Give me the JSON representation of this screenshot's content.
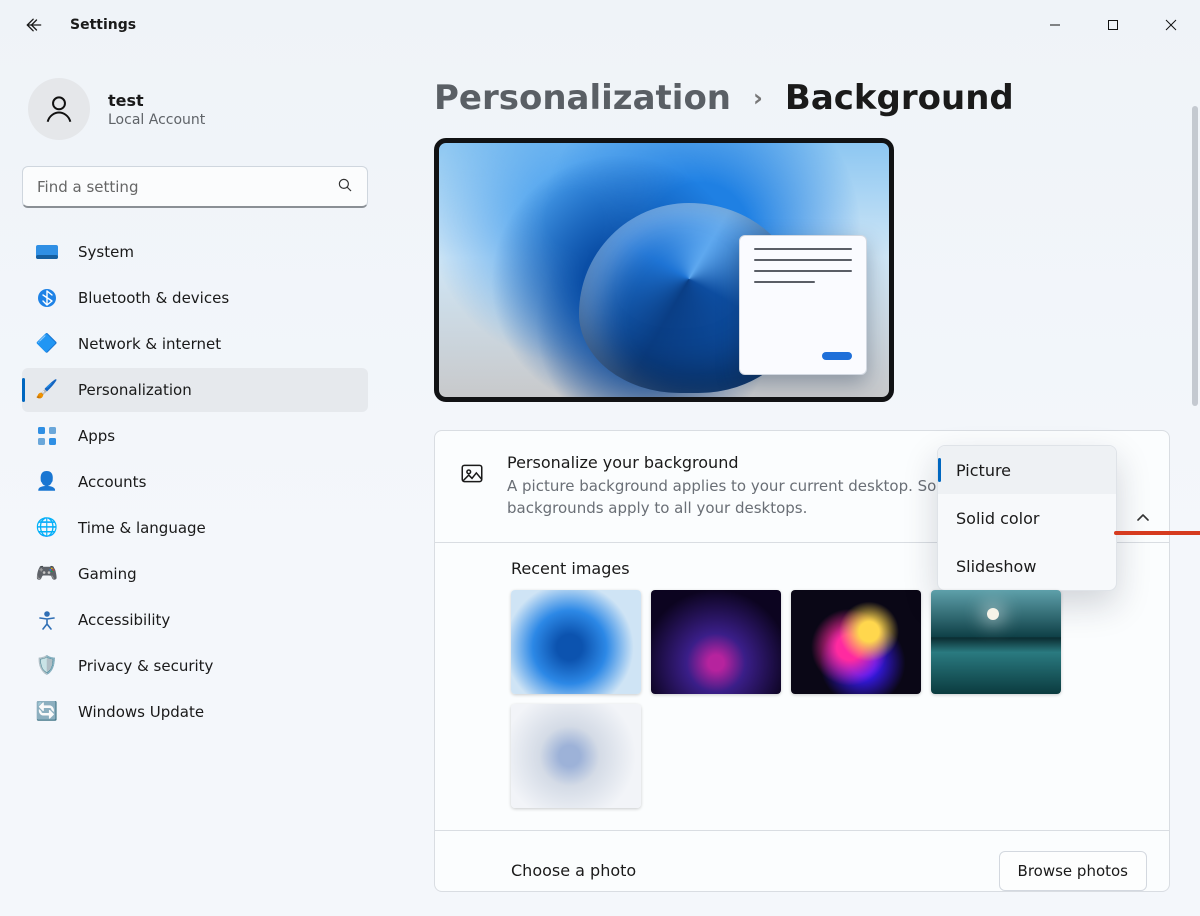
{
  "window": {
    "app_title": "Settings",
    "controls": {
      "minimize": "minimize",
      "maximize": "maximize",
      "close": "close"
    }
  },
  "user": {
    "name": "test",
    "sub": "Local Account"
  },
  "search": {
    "placeholder": "Find a setting"
  },
  "sidebar": {
    "items": [
      {
        "id": "system",
        "label": "System",
        "icon": "system-icon",
        "selected": false
      },
      {
        "id": "bluetooth",
        "label": "Bluetooth & devices",
        "icon": "bluetooth-icon",
        "selected": false
      },
      {
        "id": "network",
        "label": "Network & internet",
        "icon": "network-icon",
        "selected": false
      },
      {
        "id": "personalization",
        "label": "Personalization",
        "icon": "personalize-icon",
        "selected": true
      },
      {
        "id": "apps",
        "label": "Apps",
        "icon": "apps-icon",
        "selected": false
      },
      {
        "id": "accounts",
        "label": "Accounts",
        "icon": "accounts-icon",
        "selected": false
      },
      {
        "id": "time",
        "label": "Time & language",
        "icon": "time-icon",
        "selected": false
      },
      {
        "id": "gaming",
        "label": "Gaming",
        "icon": "gaming-icon",
        "selected": false
      },
      {
        "id": "accessibility",
        "label": "Accessibility",
        "icon": "accessibility-icon",
        "selected": false
      },
      {
        "id": "privacy",
        "label": "Privacy & security",
        "icon": "privacy-icon",
        "selected": false
      },
      {
        "id": "update",
        "label": "Windows Update",
        "icon": "update-icon",
        "selected": false
      }
    ]
  },
  "breadcrumb": {
    "parent": "Personalization",
    "current": "Background"
  },
  "bg_setting": {
    "title": "Personalize your background",
    "description": "A picture background applies to your current desktop. Solid color or slideshow backgrounds apply to all your desktops.",
    "selected": "Picture",
    "options": [
      "Picture",
      "Solid color",
      "Slideshow"
    ]
  },
  "recent": {
    "title": "Recent images",
    "count": 5
  },
  "choose": {
    "label": "Choose a photo",
    "button": "Browse photos"
  },
  "colors": {
    "accent": "#0067c0",
    "annotation": "#d63b1f"
  }
}
